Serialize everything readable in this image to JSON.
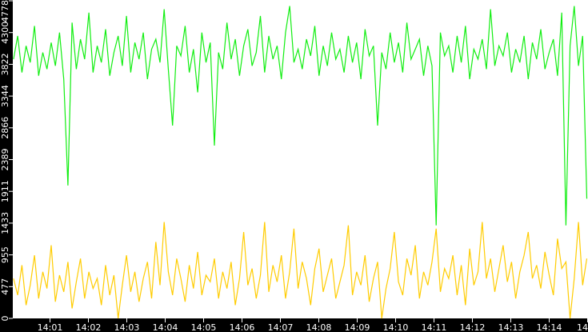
{
  "chart_data": {
    "type": "line",
    "title": "",
    "xlabel": "",
    "ylabel": "",
    "ylim": [
      0,
      4778
    ],
    "xlim_minutes_after_1400": [
      0.05,
      14.98
    ],
    "yticks": [
      "0",
      "477",
      "955",
      "1433",
      "1911",
      "2389",
      "2866",
      "3344",
      "3822",
      "4300",
      "4778"
    ],
    "xticks": [
      "14:01",
      "14:02",
      "14:03",
      "14:04",
      "14:05",
      "14:06",
      "14:07",
      "14:08",
      "14:09",
      "14:10",
      "14:11",
      "14:12",
      "14:13",
      "14:14",
      "14"
    ],
    "grid": false,
    "series": [
      {
        "name": "green",
        "color": "#11ee11",
        "values": [
          3900,
          4250,
          3700,
          4100,
          3850,
          4400,
          3650,
          4000,
          3750,
          4150,
          3800,
          4300,
          3600,
          2000,
          4450,
          3750,
          4200,
          3900,
          4600,
          3700,
          4100,
          3850,
          4350,
          3650,
          4000,
          4250,
          3800,
          4550,
          3700,
          4150,
          3900,
          4300,
          3600,
          4050,
          4200,
          3850,
          4650,
          3750,
          2900,
          4100,
          3950,
          4400,
          3700,
          4050,
          3400,
          4300,
          3850,
          4150,
          2600,
          4000,
          3750,
          4450,
          3900,
          4200,
          3650,
          4100,
          4350,
          3800,
          4000,
          4550,
          3700,
          4250,
          3900,
          4100,
          3600,
          4300,
          4700,
          3850,
          4050,
          3750,
          4200,
          3950,
          4400,
          3650,
          4100,
          3800,
          4300,
          3900,
          4050,
          3700,
          4250,
          3850,
          4150,
          3600,
          4350,
          3950,
          4100,
          2900,
          4000,
          3750,
          4300,
          3850,
          4150,
          3700,
          4450,
          3900,
          4050,
          4200,
          3650,
          4100,
          3800,
          1400,
          4300,
          3950,
          4100,
          3700,
          4250,
          3850,
          4400,
          3600,
          4050,
          3900,
          4200,
          3750,
          4650,
          3800,
          4100,
          3950,
          4300,
          3700,
          4050,
          3850,
          4250,
          3600,
          4150,
          3900,
          4350,
          3750,
          4000,
          4200,
          3650,
          4600,
          1400,
          4100,
          4700,
          3800,
          4250,
          1800
        ]
      },
      {
        "name": "yellow",
        "color": "#ffcc00",
        "values": [
          600,
          350,
          800,
          200,
          500,
          950,
          300,
          700,
          450,
          1100,
          250,
          650,
          400,
          850,
          150,
          550,
          900,
          300,
          700,
          450,
          600,
          200,
          800,
          350,
          650,
          0,
          500,
          950,
          400,
          700,
          250,
          600,
          850,
          300,
          1150,
          500,
          1450,
          700,
          350,
          900,
          600,
          250,
          800,
          450,
          1000,
          350,
          650,
          550,
          900,
          300,
          700,
          450,
          850,
          200,
          600,
          1300,
          500,
          750,
          300,
          650,
          1450,
          400,
          800,
          550,
          950,
          300,
          700,
          1350,
          450,
          850,
          600,
          200,
          750,
          1050,
          400,
          650,
          900,
          300,
          550,
          800,
          1400,
          350,
          700,
          500,
          950,
          250,
          600,
          850,
          0,
          450,
          750,
          1300,
          550,
          350,
          900,
          650,
          1100,
          300,
          700,
          500,
          850,
          1350,
          400,
          750,
          600,
          950,
          350,
          800,
          200,
          1050,
          500,
          700,
          1450,
          600,
          900,
          400,
          750,
          1100,
          550,
          850,
          300,
          700,
          950,
          1300,
          600,
          800,
          450,
          1000,
          650,
          350,
          1200,
          750,
          850,
          0,
          600,
          1450,
          500,
          900
        ]
      }
    ]
  }
}
